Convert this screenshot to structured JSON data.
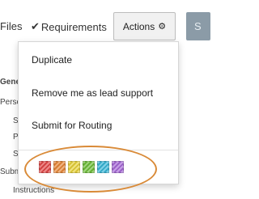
{
  "toolbar": {
    "files_label": "Files",
    "requirements_label": "Requirements",
    "actions_label": "Actions",
    "side_button_label": "S"
  },
  "sidebar": {
    "labels": [
      "Gener",
      "Perso",
      "S",
      "P",
      "S",
      "Subm",
      "Instructions"
    ]
  },
  "actions_menu": {
    "items": [
      {
        "label": "Duplicate"
      },
      {
        "label": "Remove me as lead support"
      },
      {
        "label": "Submit for Routing"
      }
    ],
    "color_swatches": [
      {
        "color": "#e34a4a",
        "pattern": "stripes"
      },
      {
        "color": "#e8893a",
        "pattern": "stripes"
      },
      {
        "color": "#e8d23a",
        "pattern": "stripes"
      },
      {
        "color": "#6fbf3a",
        "pattern": "stripes"
      },
      {
        "color": "#3ab7d8",
        "pattern": "stripes"
      },
      {
        "color": "#a86ad8",
        "pattern": "stripes"
      }
    ]
  },
  "annotation": {
    "highlight_color": "#d98a37"
  }
}
